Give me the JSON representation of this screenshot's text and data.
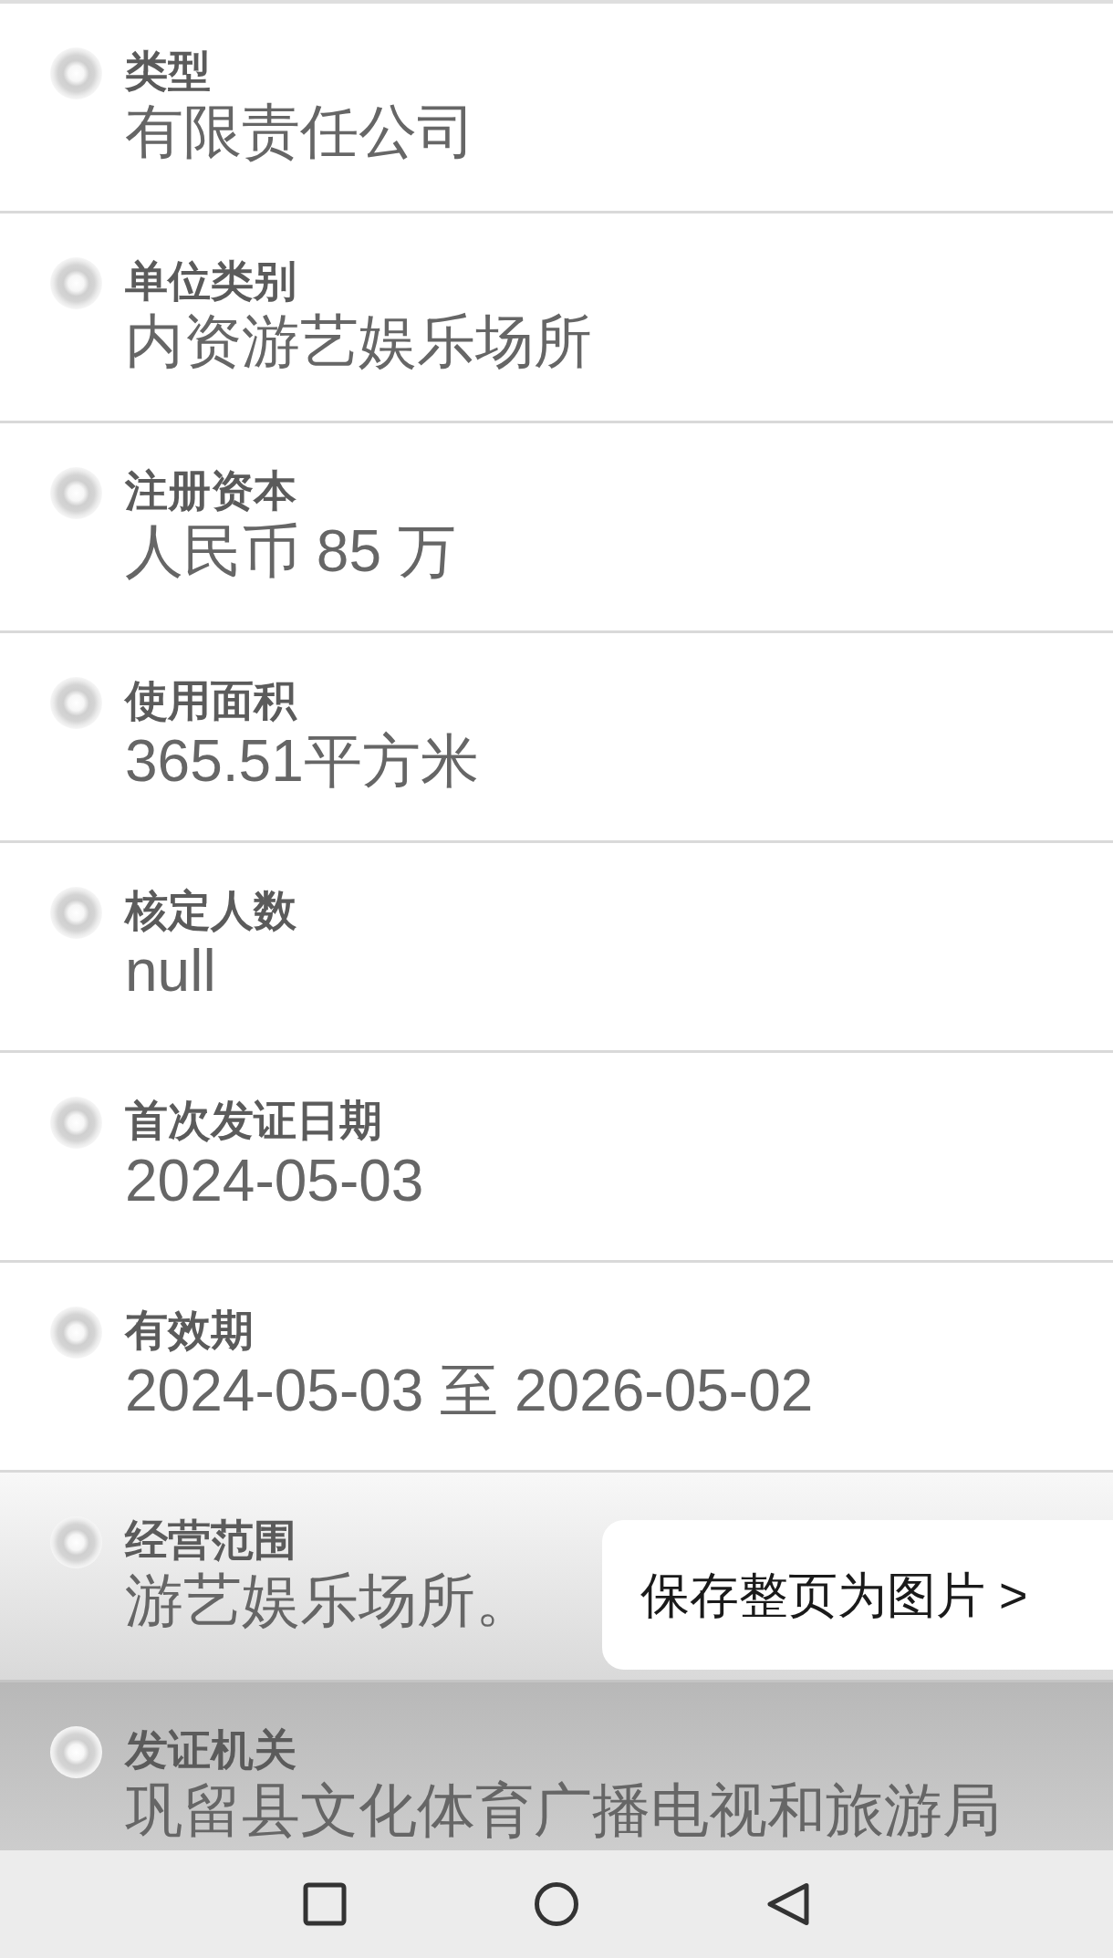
{
  "fields": [
    {
      "label": "类型",
      "value": "有限责任公司"
    },
    {
      "label": "单位类别",
      "value": "内资游艺娱乐场所"
    },
    {
      "label": "注册资本",
      "value": "人民币 85 万"
    },
    {
      "label": "使用面积",
      "value": "365.51平方米"
    },
    {
      "label": "核定人数",
      "value": "null"
    },
    {
      "label": "首次发证日期",
      "value": "2024-05-03"
    },
    {
      "label": "有效期",
      "value": "2024-05-03 至 2026-05-02"
    },
    {
      "label": "经营范围",
      "value": "游艺娱乐场所。"
    },
    {
      "label": "发证机关",
      "value": "巩留县文化体育广播电视和旅游局"
    }
  ],
  "save_button": {
    "label": "保存整页为图片 >"
  }
}
